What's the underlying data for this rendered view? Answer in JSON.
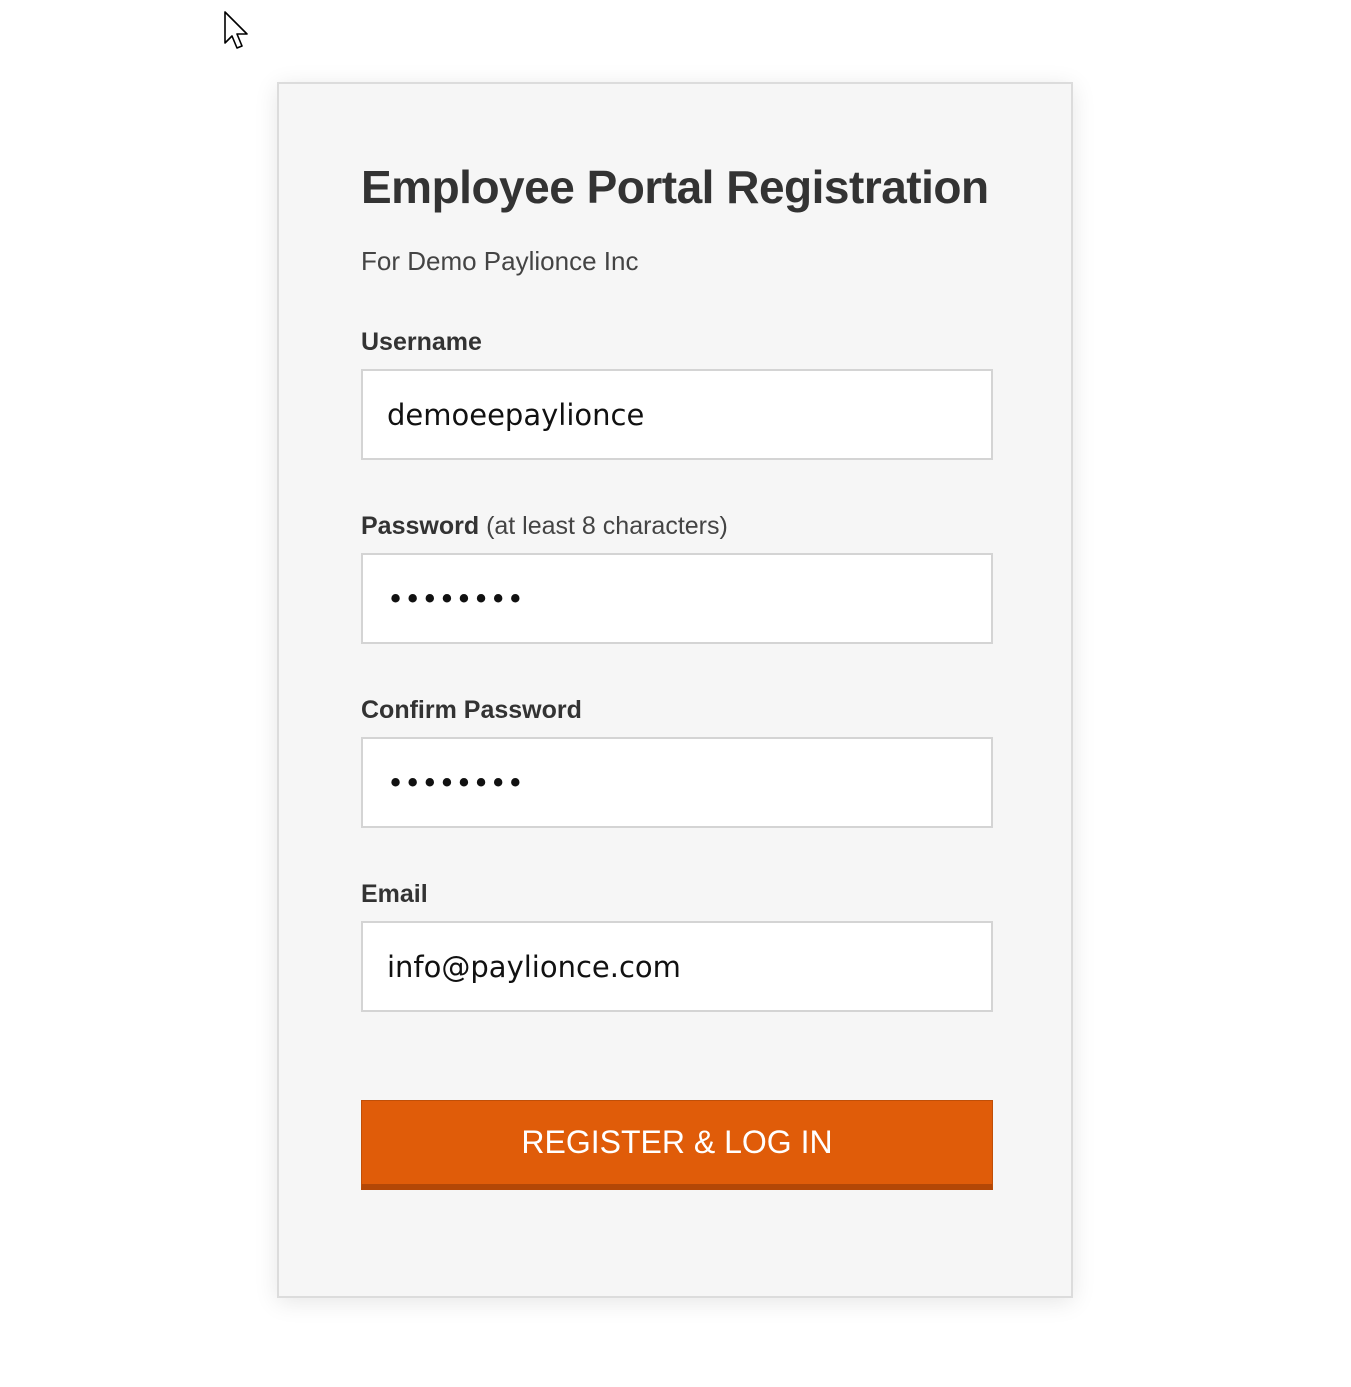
{
  "form": {
    "title": "Employee Portal Registration",
    "subtitle": "For Demo Paylionce Inc",
    "username": {
      "label": "Username",
      "value": "demoeepaylionce"
    },
    "password": {
      "label": "Password",
      "hint": "(at least 8 characters)",
      "value": "••••••••"
    },
    "confirm_password": {
      "label": "Confirm Password",
      "value": "••••••••"
    },
    "email": {
      "label": "Email",
      "value": "info@paylionce.com"
    },
    "submit_label": "REGISTER & LOG IN"
  },
  "colors": {
    "accent": "#e05c09",
    "card_background": "#f6f6f6",
    "text": "#333333"
  },
  "icons": {
    "cursor": "mouse-pointer-icon"
  }
}
